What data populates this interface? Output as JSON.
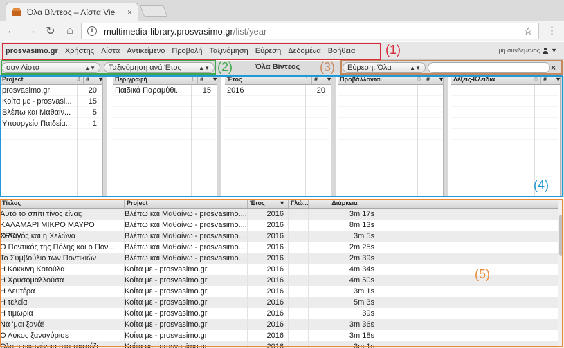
{
  "browser": {
    "tab_title": "Όλα Βίντεος – Λίστα Vie",
    "tab_close": "×",
    "url_host": "multimedia-library.prosvasimo.gr",
    "url_path": "/list/year",
    "info_icon_glyph": "i"
  },
  "menubar": {
    "brand": "prosvasimo.gr",
    "items": [
      "Χρήστης",
      "Λίστα",
      "Αντικείμενο",
      "Προβολή",
      "Ταξινόμηση",
      "Εύρεση",
      "Δεδομένα",
      "Βοήθεια"
    ],
    "status": "μη συνδεμένος"
  },
  "toolbar": {
    "view_select": "σαν Λίστα",
    "sort_select": "Ταξινόμηση ανά Έτος",
    "title": "Όλα Βίντεος",
    "find_select": "Εύρεση: Όλα",
    "search_value": "",
    "clear": "×"
  },
  "panes": [
    {
      "header": "Project",
      "count": "4",
      "num_header": "#",
      "rows": [
        {
          "name": "prosvasimo.gr",
          "n": "20"
        },
        {
          "name": "Κοίτα με - prosvasi...",
          "n": "15"
        },
        {
          "name": "Βλέπω και Μαθαίν...",
          "n": "5"
        },
        {
          "name": "Υπουργείο Παιδεία...",
          "n": "1"
        }
      ]
    },
    {
      "header": "Περιγραφή",
      "count": "1",
      "num_header": "#",
      "rows": [
        {
          "name": "Παιδικά Παραμύθι...",
          "n": "15"
        }
      ]
    },
    {
      "header": "Έτος",
      "count": "1",
      "num_header": "#",
      "rows": [
        {
          "name": "2016",
          "n": "20"
        }
      ]
    },
    {
      "header": "Προβάλλονται",
      "count": "0",
      "num_header": "#",
      "rows": []
    },
    {
      "header": "Λέξεις-Κλειδιά",
      "count": "0",
      "num_header": "#",
      "rows": []
    }
  ],
  "tracklist": {
    "headers": {
      "title": "Τίτλος",
      "project": "Project",
      "year": "Έτος",
      "lang": "Γλώ...",
      "duration": "Διάρκεια"
    },
    "rows": [
      {
        "title": "Αυτό το σπίτι τίνος είναι;",
        "project": "Βλέπω και Μαθαίνω - prosvasimo....",
        "year": "2016",
        "lang": "",
        "duration": "3m 17s"
      },
      {
        "title": "ΚΑΛΑΜΑΡΙ ΜΙΚΡΟ ΜΑΥΡΟ ΧΡΩΜ...",
        "project": "Βλέπω και Μαθαίνω - prosvasimo....",
        "year": "2016",
        "lang": "",
        "duration": "8m 13s"
      },
      {
        "title": "Ο Λαγός και η Χελώνα",
        "project": "Βλέπω και Μαθαίνω - prosvasimo....",
        "year": "2016",
        "lang": "",
        "duration": "3m 5s"
      },
      {
        "title": "Ο Ποντικός της Πόλης και ο Πον...",
        "project": "Βλέπω και Μαθαίνω - prosvasimo....",
        "year": "2016",
        "lang": "",
        "duration": "2m 25s"
      },
      {
        "title": "Το Συμβούλιο των Ποντικιών",
        "project": "Βλέπω και Μαθαίνω - prosvasimo....",
        "year": "2016",
        "lang": "",
        "duration": "2m 39s"
      },
      {
        "title": "Η Κόκκινη Κοτούλα",
        "project": "Κοίτα με - prosvasimo.gr",
        "year": "2016",
        "lang": "",
        "duration": "4m 34s"
      },
      {
        "title": "Η Χρυσομαλλούσα",
        "project": "Κοίτα με - prosvasimo.gr",
        "year": "2016",
        "lang": "",
        "duration": "4m 50s"
      },
      {
        "title": "Η Δευτέρα",
        "project": "Κοίτα με - prosvasimo.gr",
        "year": "2016",
        "lang": "",
        "duration": "3m 1s"
      },
      {
        "title": "Η τελεία",
        "project": "Κοίτα με - prosvasimo.gr",
        "year": "2016",
        "lang": "",
        "duration": "5m 3s"
      },
      {
        "title": "Η τιμωρία",
        "project": "Κοίτα με - prosvasimo.gr",
        "year": "2016",
        "lang": "",
        "duration": "39s"
      },
      {
        "title": "Να 'μαι ξανά!",
        "project": "Κοίτα με - prosvasimo.gr",
        "year": "2016",
        "lang": "",
        "duration": "3m 36s"
      },
      {
        "title": "Ο Λύκος ξαναγύρισε",
        "project": "Κοίτα με - prosvasimo.gr",
        "year": "2016",
        "lang": "",
        "duration": "3m 18s"
      },
      {
        "title": "Όλη η οικογένεια στο τραπέζι",
        "project": "Κοίτα με - prosvasimo.gr",
        "year": "2016",
        "lang": "",
        "duration": "3m 1s"
      }
    ]
  },
  "annotations": {
    "a1": "(1)",
    "a2": "(2)",
    "a3": "(3)",
    "a4": "(4)",
    "a5": "(5)"
  },
  "colors": {
    "red": "#d42c3a",
    "green": "#3ea84a",
    "tan": "#c7895b",
    "blue": "#1f9ad6",
    "orange": "#ec8a36"
  }
}
